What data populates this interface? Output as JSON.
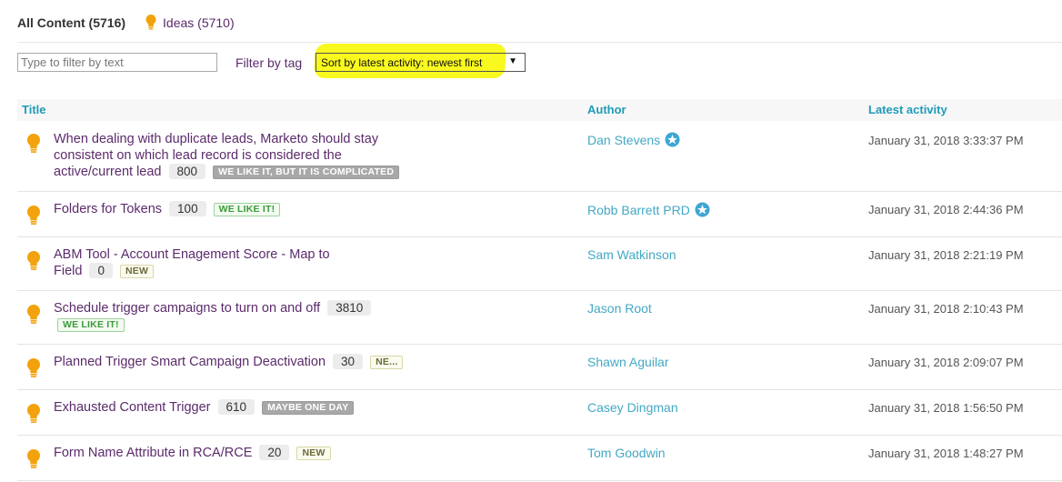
{
  "tabs": {
    "all_label": "All Content (5716)",
    "ideas_label": "Ideas (5710)"
  },
  "filters": {
    "text_placeholder": "Type to filter by text",
    "tag_label": "Filter by tag",
    "sort_value": "Sort by latest activity: newest first"
  },
  "table": {
    "headers": {
      "title": "Title",
      "author": "Author",
      "latest": "Latest activity"
    },
    "rows": [
      {
        "title": "When dealing with duplicate leads, Marketo should stay consistent on which lead record is considered the active/current lead",
        "count": "800",
        "status": "WE LIKE IT, BUT IT IS COMPLICATED",
        "author": "Dan Stevens",
        "date": "January 31, 2018 3:33:37 PM"
      },
      {
        "title": "Folders for Tokens",
        "count": "100",
        "status": "WE LIKE IT!",
        "author": "Robb Barrett PRD",
        "date": "January 31, 2018 2:44:36 PM"
      },
      {
        "title": "ABM Tool - Account Enagement Score - Map to Field",
        "count": "0",
        "status": "NEW",
        "author": "Sam Watkinson",
        "date": "January 31, 2018 2:21:19 PM"
      },
      {
        "title": "Schedule trigger campaigns to turn on and off",
        "count": "3810",
        "status": "WE LIKE IT!",
        "author": "Jason Root",
        "date": "January 31, 2018 2:10:43 PM"
      },
      {
        "title": "Planned Trigger Smart Campaign Deactivation",
        "count": "30",
        "status": "NE...",
        "author": "Shawn Aguilar",
        "date": "January 31, 2018 2:09:07 PM"
      },
      {
        "title": "Exhausted Content Trigger",
        "count": "610",
        "status": "MAYBE ONE DAY",
        "author": "Casey Dingman",
        "date": "January 31, 2018 1:56:50 PM"
      },
      {
        "title": "Form Name Attribute in RCA/RCE",
        "count": "20",
        "status": "NEW",
        "author": "Tom Goodwin",
        "date": "January 31, 2018 1:48:27 PM"
      }
    ]
  },
  "colors": {
    "bulb": "#f2a20c",
    "accent": "#1f9bb8",
    "title_link": "#5b2b6b",
    "author_link": "#44a8c4",
    "highlight": "#f9f81f"
  }
}
